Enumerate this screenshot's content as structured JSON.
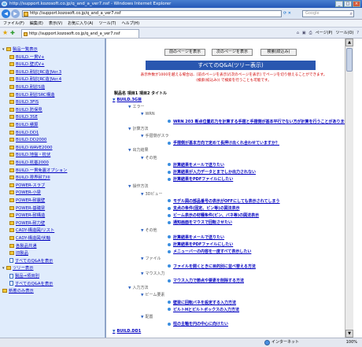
{
  "window": {
    "title": "http://support.kozosoft.co.jp/q_and_a_ver7.nsf - Windows Internet Explorer"
  },
  "address": {
    "url": "http://support.kozosoft.co.jp/q_and_a_ver7.nsf"
  },
  "search": {
    "placeholder": "Google"
  },
  "menu": [
    "ファイル(F)",
    "編集(E)",
    "表示(V)",
    "お気に入り(A)",
    "ツール(T)",
    "ヘルプ(H)"
  ],
  "tab": {
    "label": "http://support.kozosoft.co.jp/q_and_a_ver7.nsf"
  },
  "commandbar": {
    "page": "ページ(P)",
    "tools": "ツール(O)"
  },
  "sidebar": {
    "items": [
      {
        "label": "製品一覧表示",
        "kind": "folder-open"
      },
      {
        "label": "BUILD.一貫V+",
        "kind": "folder"
      },
      {
        "label": "BUILD.壁式V+",
        "kind": "folder"
      },
      {
        "label": "BUILD.耐診[RC造]Ver.3",
        "kind": "folder"
      },
      {
        "label": "BUILD.耐診[RC造]Ver.4",
        "kind": "folder"
      },
      {
        "label": "BUILD.耐診S造",
        "kind": "folder"
      },
      {
        "label": "BUILD.耐診SRC構造",
        "kind": "folder"
      },
      {
        "label": "BUILD.3FIS",
        "kind": "folder"
      },
      {
        "label": "BUILD.防保見",
        "kind": "folder"
      },
      {
        "label": "BUILD.3SE",
        "kind": "folder"
      },
      {
        "label": "BUILD.積算",
        "kind": "folder"
      },
      {
        "label": "BUILD.DD1",
        "kind": "folder"
      },
      {
        "label": "BUILD.DD2000",
        "kind": "folder"
      },
      {
        "label": "BUILD.WAVE2000",
        "kind": "folder"
      },
      {
        "label": "BUILD.地盤・杭伏",
        "kind": "folder"
      },
      {
        "label": "BUILD.杭基2000",
        "kind": "folder"
      },
      {
        "label": "BUILD.一貫免震オプション",
        "kind": "folder"
      },
      {
        "label": "BUILD.限界耐力III",
        "kind": "folder"
      },
      {
        "label": "POWER-スラブ",
        "kind": "folder"
      },
      {
        "label": "POWER-小梁",
        "kind": "folder"
      },
      {
        "label": "POWER-耐震壁",
        "kind": "folder"
      },
      {
        "label": "POWER-基礎梁",
        "kind": "folder"
      },
      {
        "label": "POWER-耐構造",
        "kind": "folder"
      },
      {
        "label": "POWER-耐力壁",
        "kind": "folder"
      },
      {
        "label": "CADY-構造図/リスト",
        "kind": "folder"
      },
      {
        "label": "CADY-構造図/伏軸",
        "kind": "folder"
      },
      {
        "label": "各製品共通",
        "kind": "folder"
      },
      {
        "label": "旧製品",
        "kind": "folder"
      },
      {
        "label": "すべてのQ&Aを表示",
        "kind": "page"
      },
      {
        "label": "ツリー表示",
        "kind": "folder-open"
      },
      {
        "label": "製品→項目別",
        "kind": "page"
      },
      {
        "label": "すべてのQ&Aを表示",
        "kind": "page"
      },
      {
        "label": "新着のみ表示",
        "kind": "folder"
      }
    ]
  },
  "main": {
    "buttons": {
      "prev": "前のページを表示",
      "next": "次のページを表示",
      "search": "検索(絞込み)"
    },
    "banner": "すべてのQ&A(ツリー表示)",
    "note1": "表示件数が1000を越える場合は、[前のページを表示]/[次のページを表示] でページを切り替えることができます。",
    "note2": "(検索(絞込み)) で検索を行うことも可能です。",
    "columns": "製品名 項目1 項目2 タイトル",
    "rows": [
      {
        "level": 0,
        "text": "BUILD.3G目",
        "type": "cat"
      },
      {
        "level": 1,
        "text": "エラー",
        "type": "node"
      },
      {
        "level": 2,
        "text": "WRN",
        "type": "node"
      },
      {
        "level": 3,
        "text": "WRN 203 断点位置応力を計算する手摺と手摺側が基本平行でない方が計算を行うことがありません",
        "type": "q"
      },
      {
        "level": 1,
        "text": "計算方法",
        "type": "node"
      },
      {
        "level": 2,
        "text": "手摺側がスラ",
        "type": "node"
      },
      {
        "level": 3,
        "text": "手摺側が基本方向で定めて長押け出くれ合わせていますか？",
        "type": "q"
      },
      {
        "level": 1,
        "text": "出力結果",
        "type": "node"
      },
      {
        "level": 2,
        "text": "その他",
        "type": "node"
      },
      {
        "level": 3,
        "text": "計算結果をメールで送りたい",
        "type": "q"
      },
      {
        "level": 3,
        "text": "計算結果が入力データとまでしか出力されない",
        "type": "q"
      },
      {
        "level": 3,
        "text": "計算結果をPDFファイルにしたい",
        "type": "q"
      },
      {
        "level": 1,
        "text": "操作方法",
        "type": "node"
      },
      {
        "level": 2,
        "text": "3Dビュー",
        "type": "node"
      },
      {
        "level": 3,
        "text": "モデル図の部品番号の表示がOFFにしても表示されてしまう",
        "type": "q"
      },
      {
        "level": 3,
        "text": "支点の条件(固定、ピン等)の図法表示",
        "type": "q"
      },
      {
        "level": 3,
        "text": "ビーム表示の材種条件(ピン、バネ等)の図法表示",
        "type": "q"
      },
      {
        "level": 3,
        "text": "通知画面をマウスで回転させたい",
        "type": "q"
      },
      {
        "level": 2,
        "text": "その他",
        "type": "node"
      },
      {
        "level": 3,
        "text": "計算結果をメールで送りたい",
        "type": "q"
      },
      {
        "level": 3,
        "text": "計算結果をPDFファイルにしたい",
        "type": "q"
      },
      {
        "level": 3,
        "text": "メニューバーの内容を一度すべて表示したい",
        "type": "q"
      },
      {
        "level": 2,
        "text": "ファイル",
        "type": "node"
      },
      {
        "level": 3,
        "text": "ファイルを開くときに目的別に並べ替える方法",
        "type": "q"
      },
      {
        "level": 2,
        "text": "マウス入力",
        "type": "node"
      },
      {
        "level": 3,
        "text": "マウス入力で節点や要素を削除する方法",
        "type": "q"
      },
      {
        "level": 1,
        "text": "入力方法",
        "type": "node"
      },
      {
        "level": 2,
        "text": "ビーム要素",
        "type": "node"
      },
      {
        "level": 3,
        "text": "壁梁に回転バネを設定する入力方法",
        "type": "q"
      },
      {
        "level": 3,
        "text": "ビルトHとビルトボックスの入力方法",
        "type": "q"
      },
      {
        "level": 2,
        "text": "配置",
        "type": "node"
      },
      {
        "level": 3,
        "text": "柱の主軸を円の中心に向けたい",
        "type": "q"
      },
      {
        "level": 0,
        "text": "BUILD.DD1",
        "type": "cat"
      }
    ]
  },
  "status": {
    "zone": "インターネット",
    "zoom": "100%"
  },
  "colors": {
    "banner": "#2a57b0",
    "note": "#d00000",
    "link": "#0000c0",
    "sidebar_bg": "#e0ecfc"
  }
}
